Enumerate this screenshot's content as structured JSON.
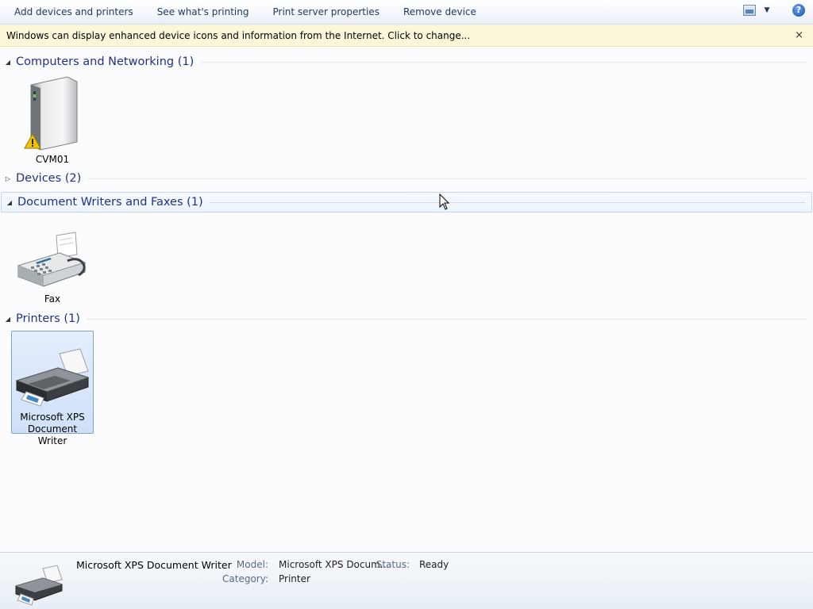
{
  "toolbar": {
    "buttons": [
      "Add devices and printers",
      "See what's printing",
      "Print server properties",
      "Remove device"
    ],
    "view_icon": "change-view-icon",
    "more_icon": "chevron-down-icon",
    "help_icon": "help-icon",
    "help_glyph": "?"
  },
  "infobar": {
    "message": "Windows can display enhanced device icons and information from the Internet. Click to change...",
    "close_glyph": "×"
  },
  "groups": {
    "computers": {
      "title": "Computers and Networking (1)",
      "expanded": true
    },
    "devices": {
      "title": "Devices (2)",
      "expanded": false
    },
    "writers": {
      "title": "Document Writers and Faxes (1)",
      "expanded": true
    },
    "printers": {
      "title": "Printers (1)",
      "expanded": true
    }
  },
  "tiles": {
    "cvm01": {
      "label": "CVM01",
      "icon": "computer-tower-icon",
      "badge": "warning-icon"
    },
    "fax": {
      "label": "Fax",
      "icon": "fax-machine-icon"
    },
    "xps": {
      "label_line1": "Microsoft XPS",
      "label_line2": "Document Writer",
      "icon": "printer-icon",
      "selected": true
    }
  },
  "details": {
    "name": "Microsoft XPS Document Writer",
    "model_label": "Model:",
    "model_value": "Microsoft XPS Docum...",
    "status_label": "Status:",
    "status_value": "Ready",
    "category_label": "Category:",
    "category_value": "Printer"
  },
  "colors": {
    "group_title": "#1e3287",
    "toolbar_text": "#1e395b",
    "infobar_bg": "#fbf8d9",
    "selection_border": "#7da2ce"
  }
}
